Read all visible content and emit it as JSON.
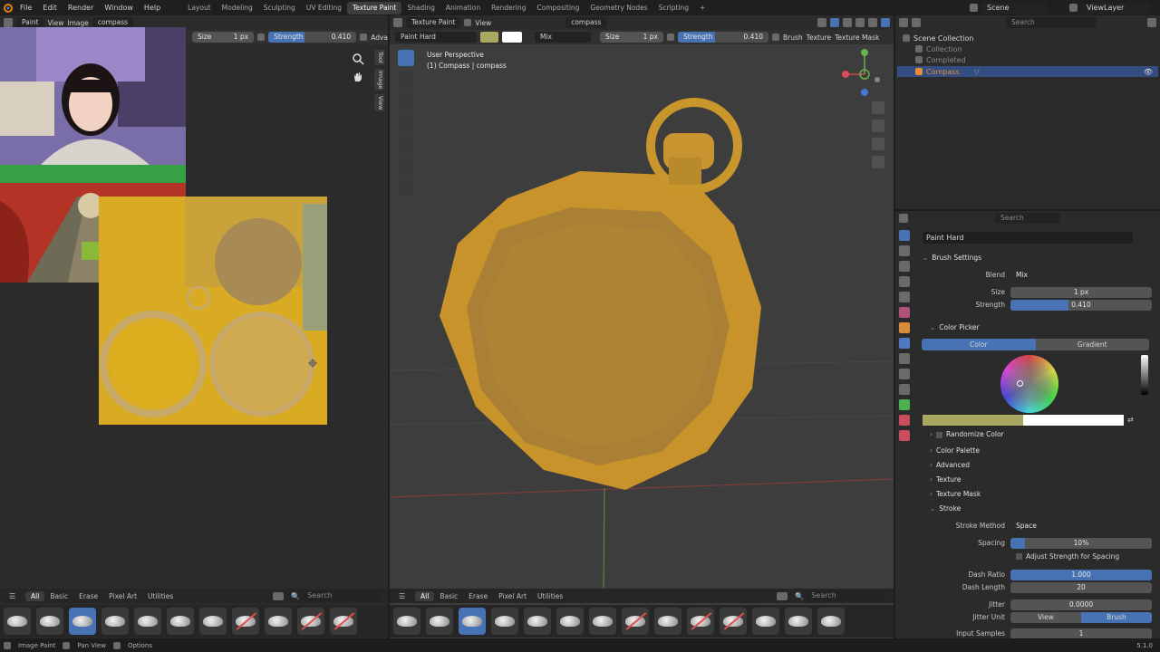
{
  "menubar": {
    "items": [
      "File",
      "Edit",
      "Render",
      "Window",
      "Help"
    ],
    "workspaces": [
      "Layout",
      "Modeling",
      "Sculpting",
      "UV Editing",
      "Texture Paint",
      "Shading",
      "Animation",
      "Rendering",
      "Compositing",
      "Geometry Nodes",
      "Scripting"
    ],
    "active_workspace": "Texture Paint",
    "add_tab": "+",
    "scene": "Scene",
    "view_layer": "ViewLayer"
  },
  "image_editor": {
    "mode": "Paint",
    "view": "View",
    "image": "Image",
    "image_name": "compass",
    "size_label": "Size",
    "size_value": "1 px",
    "strength_label": "Strength",
    "strength_value": "0.410",
    "strength_fraction": 0.41,
    "adva_label": "Adva",
    "side_tabs": [
      "Tool",
      "Image",
      "View"
    ]
  },
  "viewport": {
    "mode": "Texture Paint",
    "view": "View",
    "object": "compass",
    "brush_name": "Paint Hard",
    "blend": "Mix",
    "size_label": "Size",
    "size_value": "1 px",
    "strength_label": "Strength",
    "strength_value": "0.410",
    "menus": [
      "Brush",
      "Texture",
      "Texture Mask"
    ],
    "overlay_title": "User Perspective",
    "overlay_sub": "(1) Compass | compass",
    "color_swatch": "#a8a860"
  },
  "outliner": {
    "search_placeholder": "Search",
    "root": "Scene Collection",
    "items": [
      {
        "label": "Collection",
        "dim": true
      },
      {
        "label": "Completed",
        "dim": true
      },
      {
        "label": "Compass",
        "dim": false
      }
    ]
  },
  "properties": {
    "search_placeholder": "Search",
    "brush_name": "Paint Hard",
    "brush_settings": "Brush Settings",
    "blend_label": "Blend",
    "blend_value": "Mix",
    "size_label": "Size",
    "size_value": "1 px",
    "strength_label": "Strength",
    "strength_value": "0.410",
    "strength_fraction": 0.41,
    "color_picker": "Color Picker",
    "color_tab": "Color",
    "gradient_tab": "Gradient",
    "randomize": "Randomize Color",
    "collapsed": [
      "Color Palette",
      "Advanced",
      "Texture",
      "Texture Mask"
    ],
    "stroke": "Stroke",
    "stroke_method_label": "Stroke Method",
    "stroke_method_value": "Space",
    "spacing_label": "Spacing",
    "spacing_value": "10%",
    "spacing_fraction": 0.1,
    "adjust_strength": "Adjust Strength for Spacing",
    "dash_ratio_label": "Dash Ratio",
    "dash_ratio_value": "1.000",
    "dash_ratio_fraction": 1.0,
    "dash_length_label": "Dash Length",
    "dash_length_value": "20",
    "jitter_label": "Jitter",
    "jitter_value": "0.0000",
    "jitter_unit_label": "Jitter Unit",
    "jitter_unit_view": "View",
    "jitter_unit_brush": "Brush",
    "input_samples_label": "Input Samples",
    "input_samples_value": "1"
  },
  "asset_shelf": {
    "tabs": [
      "All",
      "Basic",
      "Erase",
      "Pixel Art",
      "Utilities"
    ],
    "search_placeholder": "Search"
  },
  "statusbar": {
    "items": [
      "Image Paint",
      "Pan View",
      "Options"
    ],
    "version": "5.1.0"
  },
  "colors": {
    "accent": "#4772b3",
    "texture_yellow": "#d9ab22",
    "compass_gold": "#c7962a"
  }
}
